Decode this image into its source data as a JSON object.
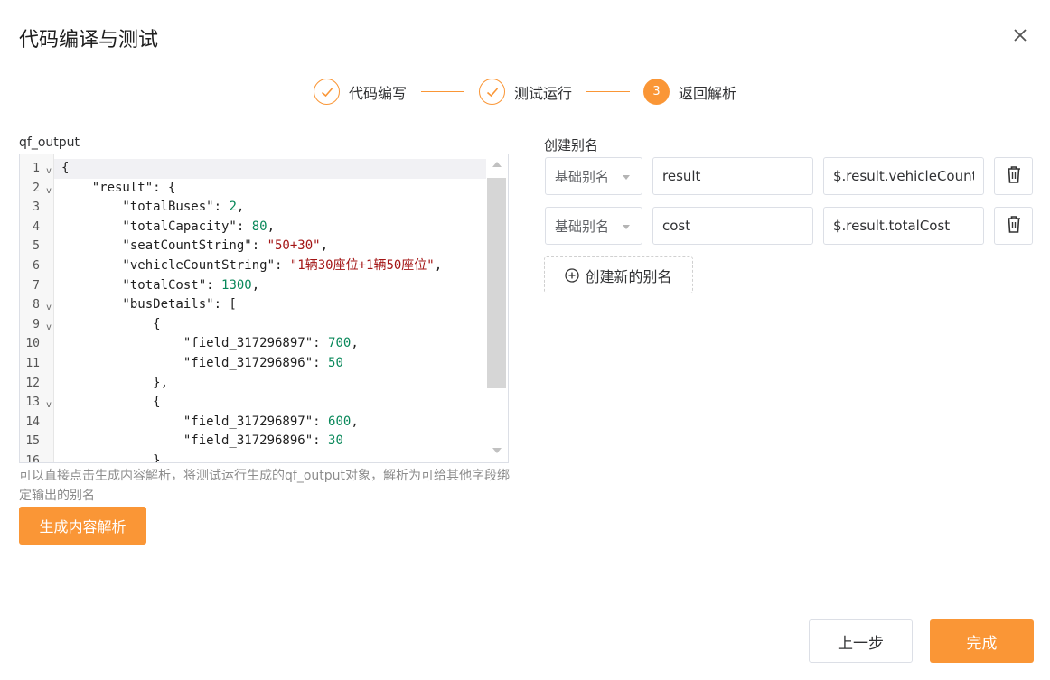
{
  "dialog": {
    "title": "代码编译与测试"
  },
  "steps": [
    {
      "label": "代码编写",
      "state": "done",
      "icon": "check-icon"
    },
    {
      "label": "测试运行",
      "state": "done",
      "icon": "check-icon"
    },
    {
      "label": "返回解析",
      "state": "active",
      "number": "3"
    }
  ],
  "editor": {
    "label": "qf_output",
    "lines": [
      {
        "n": "1",
        "fold": true,
        "tokens": [
          {
            "t": "{",
            "c": "pun"
          }
        ]
      },
      {
        "n": "2",
        "fold": true,
        "tokens": [
          {
            "t": "    \"result\": {",
            "c": "key"
          }
        ]
      },
      {
        "n": "3",
        "fold": false,
        "tokens": [
          {
            "t": "        \"totalBuses\": ",
            "c": "key"
          },
          {
            "t": "2",
            "c": "num"
          },
          {
            "t": ",",
            "c": "pun"
          }
        ]
      },
      {
        "n": "4",
        "fold": false,
        "tokens": [
          {
            "t": "        \"totalCapacity\": ",
            "c": "key"
          },
          {
            "t": "80",
            "c": "num"
          },
          {
            "t": ",",
            "c": "pun"
          }
        ]
      },
      {
        "n": "5",
        "fold": false,
        "tokens": [
          {
            "t": "        \"seatCountString\": ",
            "c": "key"
          },
          {
            "t": "\"50+30\"",
            "c": "str"
          },
          {
            "t": ",",
            "c": "pun"
          }
        ]
      },
      {
        "n": "6",
        "fold": false,
        "tokens": [
          {
            "t": "        \"vehicleCountString\": ",
            "c": "key"
          },
          {
            "t": "\"1辆30座位+1辆50座位\"",
            "c": "str"
          },
          {
            "t": ",",
            "c": "pun"
          }
        ]
      },
      {
        "n": "7",
        "fold": false,
        "tokens": [
          {
            "t": "        \"totalCost\": ",
            "c": "key"
          },
          {
            "t": "1300",
            "c": "num"
          },
          {
            "t": ",",
            "c": "pun"
          }
        ]
      },
      {
        "n": "8",
        "fold": true,
        "tokens": [
          {
            "t": "        \"busDetails\": [",
            "c": "key"
          }
        ]
      },
      {
        "n": "9",
        "fold": true,
        "tokens": [
          {
            "t": "            {",
            "c": "pun"
          }
        ]
      },
      {
        "n": "10",
        "fold": false,
        "tokens": [
          {
            "t": "                \"field_317296897\": ",
            "c": "key"
          },
          {
            "t": "700",
            "c": "num"
          },
          {
            "t": ",",
            "c": "pun"
          }
        ]
      },
      {
        "n": "11",
        "fold": false,
        "tokens": [
          {
            "t": "                \"field_317296896\": ",
            "c": "key"
          },
          {
            "t": "50",
            "c": "num"
          }
        ]
      },
      {
        "n": "12",
        "fold": false,
        "tokens": [
          {
            "t": "            },",
            "c": "pun"
          }
        ]
      },
      {
        "n": "13",
        "fold": true,
        "tokens": [
          {
            "t": "            {",
            "c": "pun"
          }
        ]
      },
      {
        "n": "14",
        "fold": false,
        "tokens": [
          {
            "t": "                \"field_317296897\": ",
            "c": "key"
          },
          {
            "t": "600",
            "c": "num"
          },
          {
            "t": ",",
            "c": "pun"
          }
        ]
      },
      {
        "n": "15",
        "fold": false,
        "tokens": [
          {
            "t": "                \"field_317296896\": ",
            "c": "key"
          },
          {
            "t": "30",
            "c": "num"
          }
        ]
      },
      {
        "n": "16",
        "fold": false,
        "tokens": [
          {
            "t": "            }",
            "c": "pun"
          }
        ]
      }
    ]
  },
  "hint": "可以直接点击生成内容解析，将测试运行生成的qf_output对象，解析为可给其他字段绑定输出的别名",
  "generate_button": "生成内容解析",
  "alias": {
    "label": "创建别名",
    "rows": [
      {
        "type": "基础别名",
        "name": "result",
        "path": "$.result.vehicleCountString"
      },
      {
        "type": "基础别名",
        "name": "cost",
        "path": "$.result.totalCost"
      }
    ],
    "add_label": "创建新的别名"
  },
  "footer": {
    "prev_label": "上一步",
    "done_label": "完成"
  },
  "colors": {
    "accent": "#fa9636"
  }
}
